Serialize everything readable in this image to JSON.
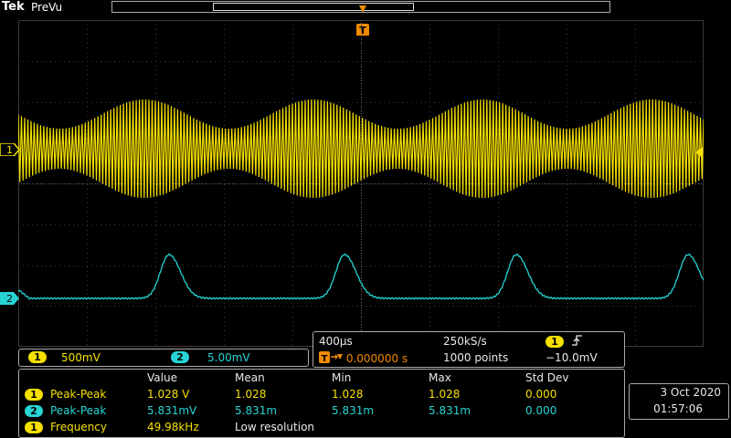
{
  "header": {
    "brand": "Tek",
    "mode": "PreVu"
  },
  "trigger": {
    "marker": "T"
  },
  "channels": {
    "ch1": {
      "id": "1",
      "scale": "500mV",
      "color": "#f5e000"
    },
    "ch2": {
      "id": "2",
      "scale": "5.00mV",
      "color": "#27d4d4"
    }
  },
  "timing": {
    "horizontal_scale": "400µs",
    "sample_rate": "250kS/s",
    "trigger_delay": "0.000000 s",
    "record_length": "1000 points",
    "trigger_source": "1",
    "trigger_slope_icon": "rising-edge-icon",
    "trigger_level": "−10.0mV"
  },
  "measurements": {
    "headers": [
      "Value",
      "Mean",
      "Min",
      "Max",
      "Std Dev"
    ],
    "rows": [
      {
        "ch": "1",
        "name": "Peak-Peak",
        "value": "1.028 V",
        "mean": "1.028",
        "min": "1.028",
        "max": "1.028",
        "std": "0.000"
      },
      {
        "ch": "2",
        "name": "Peak-Peak",
        "value": "5.831mV",
        "mean": "5.831m",
        "min": "5.831m",
        "max": "5.831m",
        "std": "0.000"
      },
      {
        "ch": "1",
        "name": "Frequency",
        "value": "49.98kHz",
        "mean": "Low resolution",
        "min": "",
        "max": "",
        "std": ""
      }
    ]
  },
  "clock": {
    "date": "3 Oct 2020",
    "time": "01:57:06"
  },
  "colors": {
    "grid": "#3a3a3a",
    "grid_center": "#6a6a6a",
    "trigger": "#f08a00",
    "ch1": "#f5e000",
    "ch2": "#27d4d4"
  }
}
